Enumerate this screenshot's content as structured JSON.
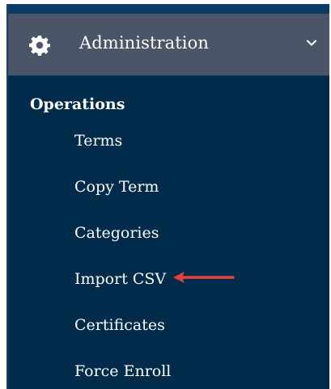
{
  "header": {
    "title": "Administration",
    "icon": "gear-icon",
    "chevron_icon": "chevron-down-icon"
  },
  "section": {
    "title": "Operations"
  },
  "nav_items": [
    {
      "label": "Terms"
    },
    {
      "label": "Copy Term"
    },
    {
      "label": "Categories"
    },
    {
      "label": "Import CSV"
    },
    {
      "label": "Certificates"
    },
    {
      "label": "Force Enroll"
    }
  ],
  "annotation": {
    "arrow_icon": "red-arrow-icon",
    "color": "#e8413c"
  },
  "colors": {
    "panel_bg": "#002b4a",
    "header_bg": "#4a5567",
    "text": "#ffffff"
  }
}
